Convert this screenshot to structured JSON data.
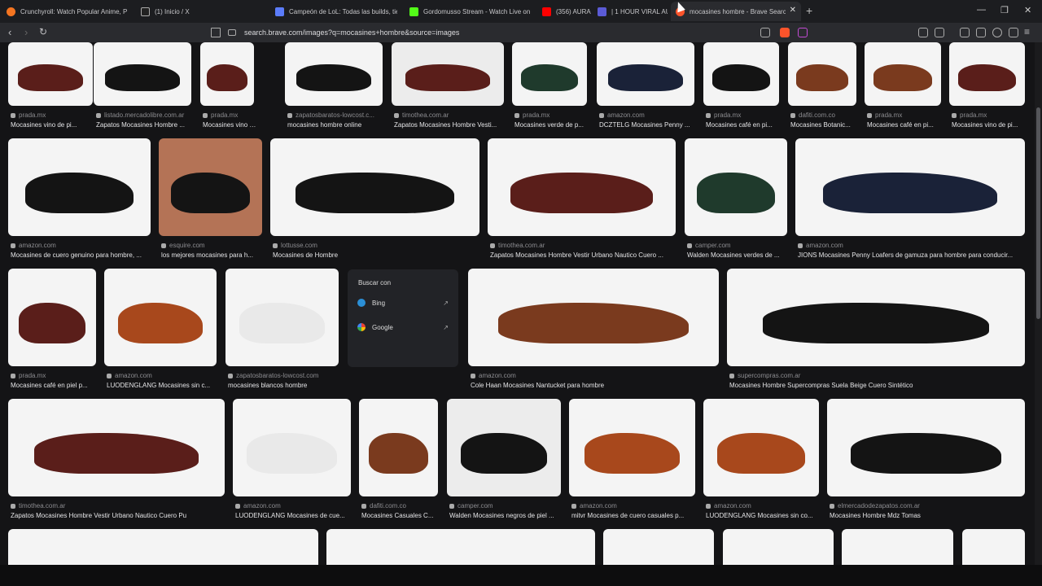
{
  "tabs": [
    {
      "title": "Crunchyroll: Watch Popular Anime, P",
      "color": "#f47521"
    },
    {
      "title": "(1) Inicio / X",
      "color": "#ffffff"
    },
    {
      "title": "Campeón de LoL: Todas las builds, tie",
      "color": "#5b7cfa"
    },
    {
      "title": "Gordomusso Stream - Watch Live on",
      "color": "#53fc18"
    },
    {
      "title": "(356) AURA",
      "color": "#ff0000"
    },
    {
      "title": "| 1 HOUR VIRAL AU",
      "color": "#5b5bd6"
    },
    {
      "title": "mocasines hombre - Brave Search",
      "color": "#fb542b"
    }
  ],
  "url": "search.brave.com/images?q=mocasines+hombre&source=images",
  "panel": {
    "heading": "Buscar con",
    "items": [
      "Bing",
      "Google"
    ]
  },
  "results": [
    {
      "src": "prada.mx",
      "cap": "Mocasines vino de pi..."
    },
    {
      "src": "listado.mercadolibre.com.ar",
      "cap": "Zapatos Mocasines Hombre ..."
    },
    {
      "src": "prada.mx",
      "cap": "Mocasines vino de pi..."
    },
    {
      "src": "zapatosbaratos-lowcost.c...",
      "cap": "mocasines hombre online"
    },
    {
      "src": "timothea.com.ar",
      "cap": "Zapatos Mocasines Hombre Vesti..."
    },
    {
      "src": "prada.mx",
      "cap": "Mocasines verde de p..."
    },
    {
      "src": "amazon.com",
      "cap": "DCZTELG Mocasines Penny ..."
    },
    {
      "src": "prada.mx",
      "cap": "Mocasines café en pi..."
    },
    {
      "src": "dafiti.com.co",
      "cap": "Mocasines Botanic..."
    },
    {
      "src": "prada.mx",
      "cap": "Mocasines café en pi..."
    },
    {
      "src": "prada.mx",
      "cap": "Mocasines vino de pi..."
    },
    {
      "src": "amazon.com",
      "cap": "Mocasines de cuero genuino para hombre, ..."
    },
    {
      "src": "esquire.com",
      "cap": "los mejores mocasines para h..."
    },
    {
      "src": "lottusse.com",
      "cap": "Mocasines de Hombre"
    },
    {
      "src": "timothea.com.ar",
      "cap": "Zapatos Mocasines Hombre Vestir Urbano Nautico Cuero ..."
    },
    {
      "src": "camper.com",
      "cap": "Walden Mocasines verdes de ..."
    },
    {
      "src": "amazon.com",
      "cap": "JIONS Mocasines Penny Loafers de gamuza para hombre para conducir..."
    },
    {
      "src": "prada.mx",
      "cap": "Mocasines café en piel p..."
    },
    {
      "src": "amazon.com",
      "cap": "LUODENGLANG Mocasines sin c..."
    },
    {
      "src": "zapatosbaratos-lowcost.com",
      "cap": "mocasines blancos hombre"
    },
    {
      "src": "amazon.com",
      "cap": "Cole Haan Mocasines Nantucket para hombre"
    },
    {
      "src": "supercompras.com.ar",
      "cap": "Mocasines Hombre Supercompras Suela Beige Cuero Sintético"
    },
    {
      "src": "timothea.com.ar",
      "cap": "Zapatos Mocasines Hombre Vestir Urbano Nautico Cuero Pu"
    },
    {
      "src": "amazon.com",
      "cap": "LUODENGLANG Mocasines de cue..."
    },
    {
      "src": "dafiti.com.co",
      "cap": "Mocasines Casuales C..."
    },
    {
      "src": "camper.com",
      "cap": "Walden Mocasines negros de piel ..."
    },
    {
      "src": "amazon.com",
      "cap": "mitvr Mocasines de cuero casuales p..."
    },
    {
      "src": "amazon.com",
      "cap": "LUODENGLANG Mocasines sin co..."
    },
    {
      "src": "elmercadodezapatos.com.ar",
      "cap": "Mocasines Hombre Mdz Tomas"
    }
  ],
  "shoe_colors": {
    "wine": "#5a1e1a",
    "brown": "#7a3a1e",
    "black": "#141414",
    "cognac": "#a8481c",
    "white": "#e9e9e9",
    "navy": "#1a2238",
    "green": "#1f3a2c"
  }
}
